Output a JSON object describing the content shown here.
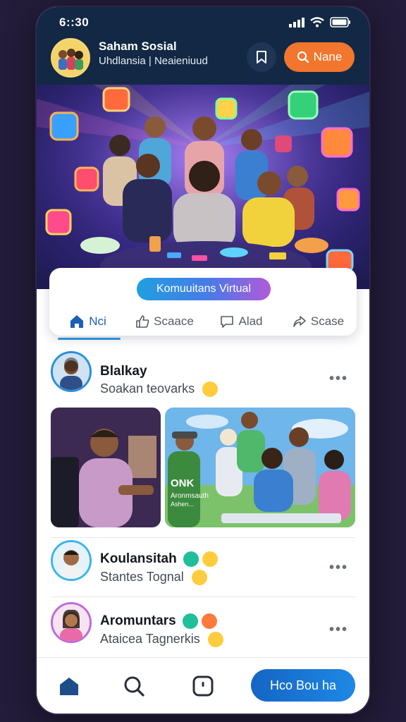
{
  "status": {
    "time": "6::30"
  },
  "header": {
    "title": "Saham Sosial",
    "subtitle": "Uhdlansia | Neaieniuud",
    "name_button": "Nane"
  },
  "community": {
    "pill_label": "Komuuitans Virtual",
    "tabs": [
      {
        "label": "Nci",
        "icon": "home-icon",
        "active": true
      },
      {
        "label": "Scaace",
        "icon": "thumbs-up-icon",
        "active": false
      },
      {
        "label": "Alad",
        "icon": "comment-icon",
        "active": false
      },
      {
        "label": "Scase",
        "icon": "share-icon",
        "active": false
      }
    ]
  },
  "posts": [
    {
      "name": "Blalkay",
      "status": "Soakan teovarks"
    },
    {
      "name": "Koulansitah",
      "status": "Stantes Tognal"
    },
    {
      "name": "Aromuntars",
      "status": "Ataicea Tagnerkis"
    }
  ],
  "photo_caption": {
    "line1": "ONK",
    "line2": "Aronmsauth",
    "line3": "Ashen..."
  },
  "bottom_nav": {
    "cta_label": "Hco Bou ha"
  },
  "colors": {
    "accent": "#f2762d",
    "header_bg": "#122844",
    "primary_blue": "#1e88e5"
  }
}
